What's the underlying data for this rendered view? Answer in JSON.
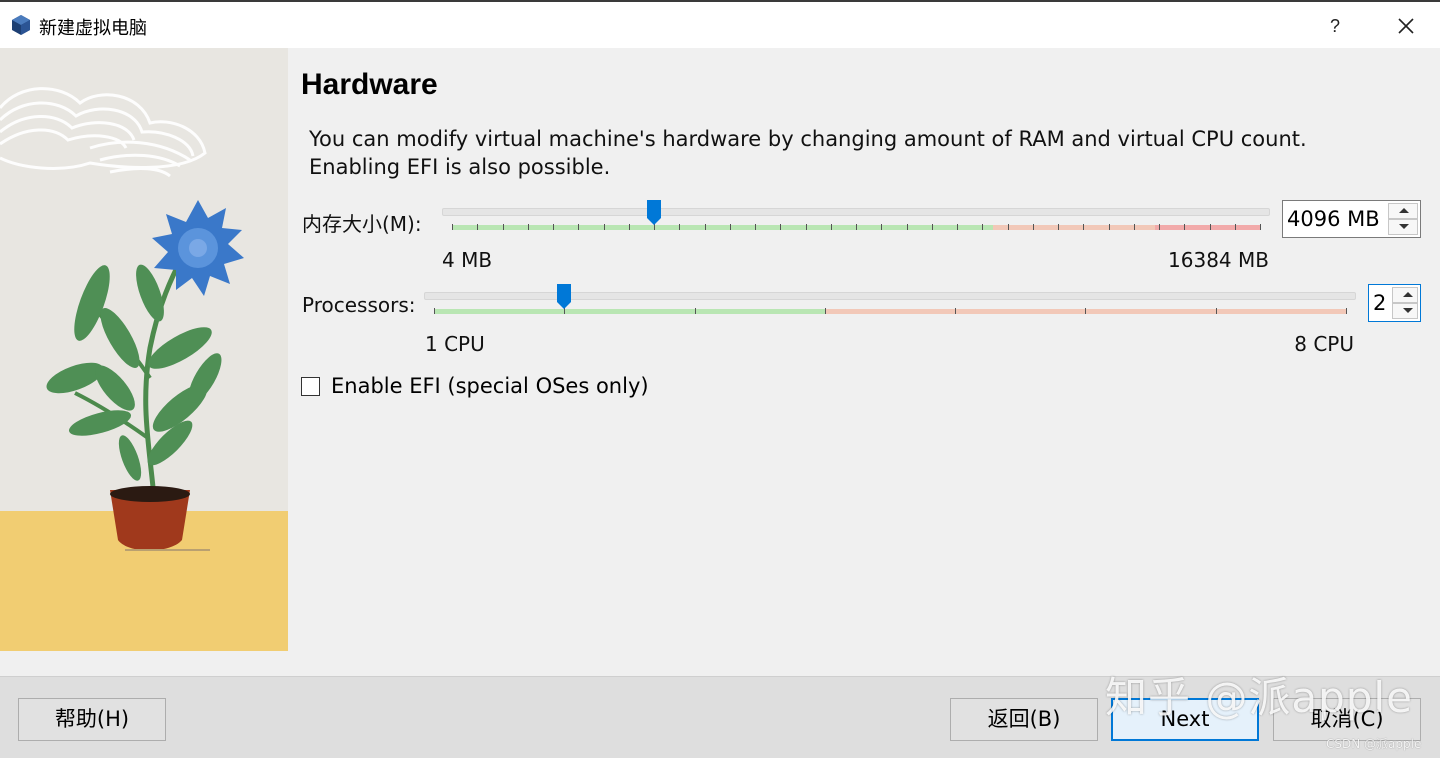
{
  "window": {
    "title": "新建虚拟电脑",
    "help_label": "?",
    "icon": "virtualbox-icon",
    "close_icon": "close-icon"
  },
  "page": {
    "heading": "Hardware",
    "description_line1": "You can modify virtual machine's hardware by changing amount of RAM and virtual CPU count.",
    "description_line2": "Enabling EFI is also possible."
  },
  "memory": {
    "label": "内存大小(M):",
    "min_label": "4 MB",
    "max_label": "16384 MB",
    "value": "4096 MB",
    "value_mb": 4096,
    "min_mb": 4,
    "max_mb": 16384,
    "recommended_fraction": 0.67,
    "warning_fraction": 0.87
  },
  "processors": {
    "label": "Processors:",
    "min_label": "1 CPU",
    "max_label": "8 CPU",
    "value": "2",
    "value_cpu": 2,
    "min_cpu": 1,
    "max_cpu": 8,
    "recommended_fraction": 0.43
  },
  "efi": {
    "label": "Enable EFI (special OSes only)",
    "checked": false
  },
  "buttons": {
    "help": "帮助(H)",
    "back": "返回(B)",
    "next": "Next",
    "cancel": "取消(C)"
  },
  "watermark": {
    "main": "知乎 @派apple",
    "small": "CSDN @派apple"
  },
  "colors": {
    "accent": "#0078d7",
    "ok_band": "#b9e6b3",
    "warn_band": "#f2c8b8",
    "danger_band": "#f2aaaa"
  }
}
